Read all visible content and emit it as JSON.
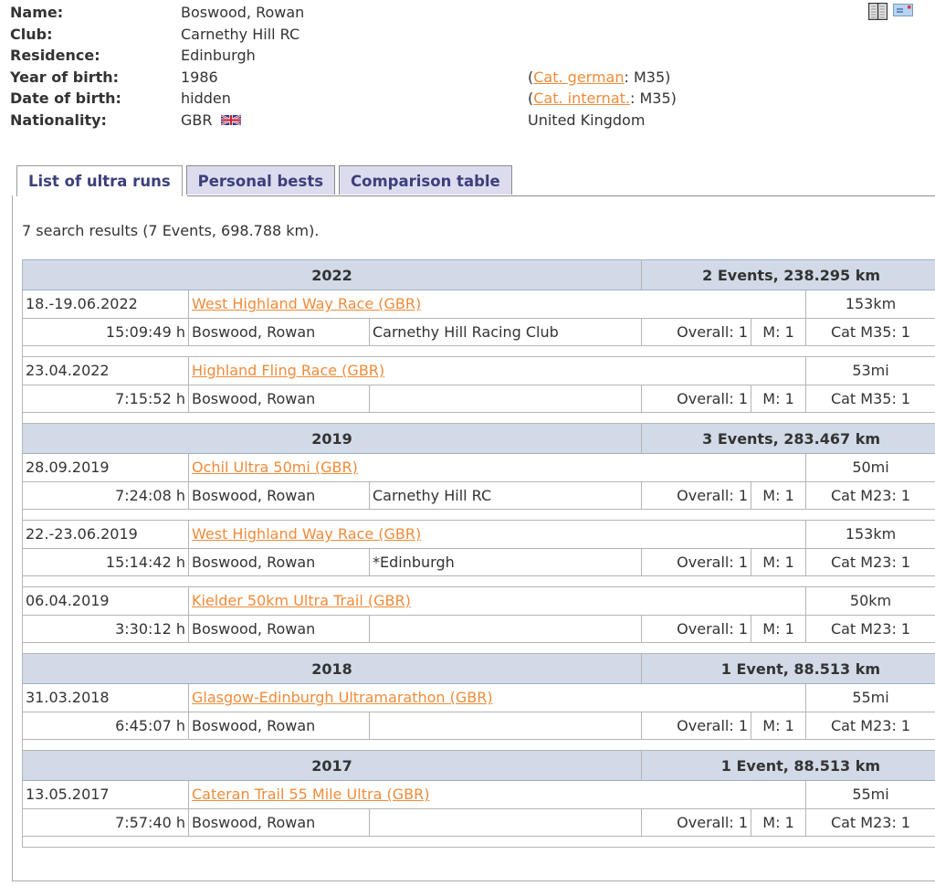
{
  "profile": {
    "fields": [
      {
        "label": "Name:",
        "value": "Boswood, Rowan",
        "extra": ""
      },
      {
        "label": "Club:",
        "value": "Carnethy Hill RC",
        "extra": ""
      },
      {
        "label": "Residence:",
        "value": "Edinburgh",
        "extra": ""
      },
      {
        "label": "Year of birth:",
        "value": "1986"
      },
      {
        "label": "Date of birth:",
        "value": "hidden"
      },
      {
        "label": "Nationality:",
        "value": "GBR"
      }
    ],
    "cat_german": {
      "link": "Cat. german",
      "value": ": M35)",
      "open": "("
    },
    "cat_internat": {
      "link": "Cat. internat.",
      "value": ": M35)",
      "open": "("
    },
    "country": "United Kingdom",
    "flag_icon": "uk-flag-icon"
  },
  "top_icons": [
    "book-icon",
    "email-icon"
  ],
  "tabs": [
    {
      "label": "List of ultra runs",
      "active": true
    },
    {
      "label": "Personal bests",
      "active": false
    },
    {
      "label": "Comparison table",
      "active": false
    }
  ],
  "summary": "7 search results (7 Events, 698.788 km).",
  "years": [
    {
      "year": "2022",
      "summary": "2 Events, 238.295 km",
      "events": [
        {
          "date": "18.-19.06.2022",
          "race": "West Highland Way Race (GBR)",
          "distance": "153km",
          "time": "15:09:49 h",
          "name": "Boswood, Rowan",
          "club": "Carnethy Hill Racing Club",
          "overall": "Overall: 1",
          "gender": "M: 1",
          "cat": "Cat M35: 1"
        },
        {
          "date": "23.04.2022",
          "race": "Highland Fling Race (GBR)",
          "distance": "53mi",
          "time": "7:15:52 h",
          "name": "Boswood, Rowan",
          "club": "",
          "overall": "Overall: 1",
          "gender": "M: 1",
          "cat": "Cat M35: 1"
        }
      ]
    },
    {
      "year": "2019",
      "summary": "3 Events, 283.467 km",
      "events": [
        {
          "date": "28.09.2019",
          "race": "Ochil Ultra 50mi (GBR)",
          "distance": "50mi",
          "time": "7:24:08 h",
          "name": "Boswood, Rowan",
          "club": "Carnethy Hill RC",
          "overall": "Overall: 1",
          "gender": "M: 1",
          "cat": "Cat M23: 1"
        },
        {
          "date": "22.-23.06.2019",
          "race": "West Highland Way Race (GBR)",
          "distance": "153km",
          "time": "15:14:42 h",
          "name": "Boswood, Rowan",
          "club": "*Edinburgh",
          "overall": "Overall: 1",
          "gender": "M: 1",
          "cat": "Cat M23: 1"
        },
        {
          "date": "06.04.2019",
          "race": "Kielder 50km Ultra Trail (GBR)",
          "distance": "50km",
          "time": "3:30:12 h",
          "name": "Boswood, Rowan",
          "club": "",
          "overall": "Overall: 1",
          "gender": "M: 1",
          "cat": "Cat M23: 1"
        }
      ]
    },
    {
      "year": "2018",
      "summary": "1 Event, 88.513 km",
      "events": [
        {
          "date": "31.03.2018",
          "race": "Glasgow-Edinburgh Ultramarathon (GBR)",
          "distance": "55mi",
          "time": "6:45:07 h",
          "name": "Boswood, Rowan",
          "club": "",
          "overall": "Overall: 1",
          "gender": "M: 1",
          "cat": "Cat M23: 1"
        }
      ]
    },
    {
      "year": "2017",
      "summary": "1 Event, 88.513 km",
      "events": [
        {
          "date": "13.05.2017",
          "race": "Cateran Trail 55 Mile Ultra (GBR)",
          "distance": "55mi",
          "time": "7:57:40 h",
          "name": "Boswood, Rowan",
          "club": "",
          "overall": "Overall: 1",
          "gender": "M: 1",
          "cat": "Cat M23: 1"
        }
      ]
    }
  ],
  "colors": {
    "link": "#f08b3a",
    "tab_text": "#3c3f7c",
    "tab_bg": "#dcdcee",
    "year_header_bg": "#d1dae6"
  }
}
